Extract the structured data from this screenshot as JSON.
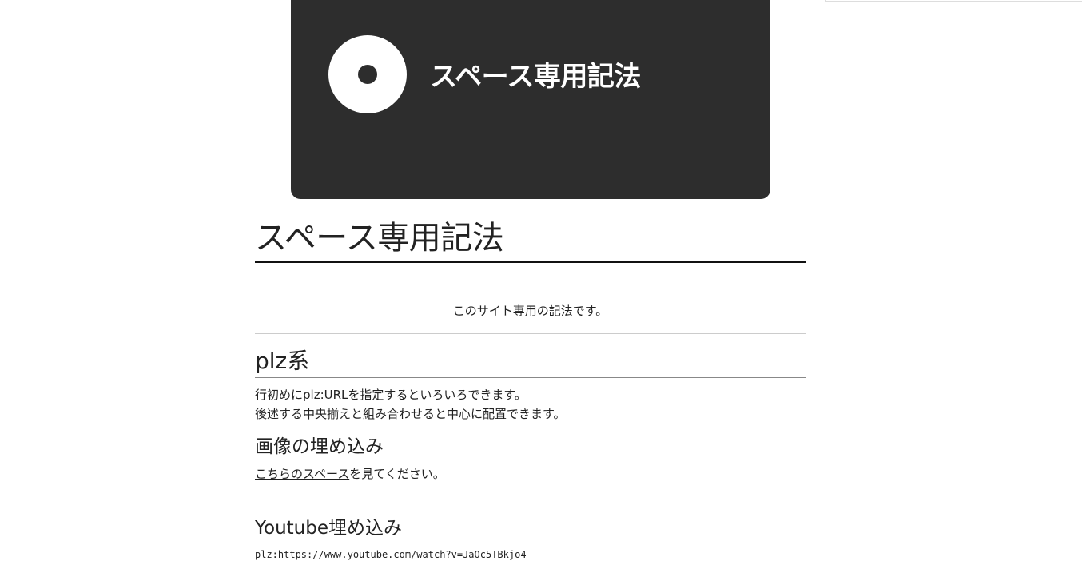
{
  "banner": {
    "title": "スペース専用記法",
    "icon": "disc-icon"
  },
  "page": {
    "title": "スペース専用記法",
    "intro": "このサイト専用の記法です。"
  },
  "sections": {
    "plz": {
      "title": "plz系",
      "line1": "行初めにplz:URLを指定するといろいろできます。",
      "line2": "後述する中央揃えと組み合わせると中心に配置できます。"
    },
    "image_embed": {
      "title": "画像の埋め込み",
      "link_text": "こちらのスペース",
      "suffix": "を見てください。"
    },
    "youtube_embed": {
      "title": "Youtube埋め込み",
      "code": "plz:https://www.youtube.com/watch?v=JaOc5TBkjo4"
    }
  }
}
